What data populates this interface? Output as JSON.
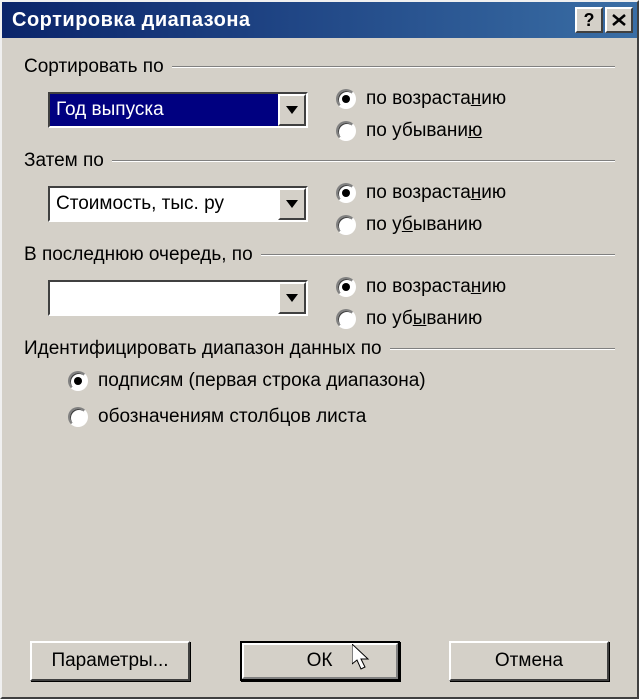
{
  "window": {
    "title": "Сортировка диапазона"
  },
  "sort1": {
    "label": "Сортировать по",
    "value": "Год выпуска",
    "asc": "по возраста",
    "asc_u": "н",
    "asc_tail": "ию",
    "desc": "по убывани",
    "desc_u": "ю",
    "selected": "asc"
  },
  "sort2": {
    "label": "Затем по",
    "value": "Стоимость, тыс. ру",
    "asc": "по возраста",
    "asc_u": "н",
    "asc_tail": "ию",
    "desc": "по у",
    "desc_u": "б",
    "desc_tail": "ыванию",
    "selected": "asc"
  },
  "sort3": {
    "label": "В последнюю очередь, по",
    "value": "",
    "asc": "по возраста",
    "asc_u": "н",
    "asc_tail": "ию",
    "desc": "по уб",
    "desc_u": "ы",
    "desc_tail": "ванию",
    "selected": "asc"
  },
  "identify": {
    "label": "Идентифицировать диапазон данных по",
    "opt1": "подписям (первая строка диапазона)",
    "opt2": "обозначениям столбцов листа",
    "selected": "opt1"
  },
  "buttons": {
    "options": "Параметры...",
    "ok": "ОК",
    "cancel": "Отмена"
  }
}
